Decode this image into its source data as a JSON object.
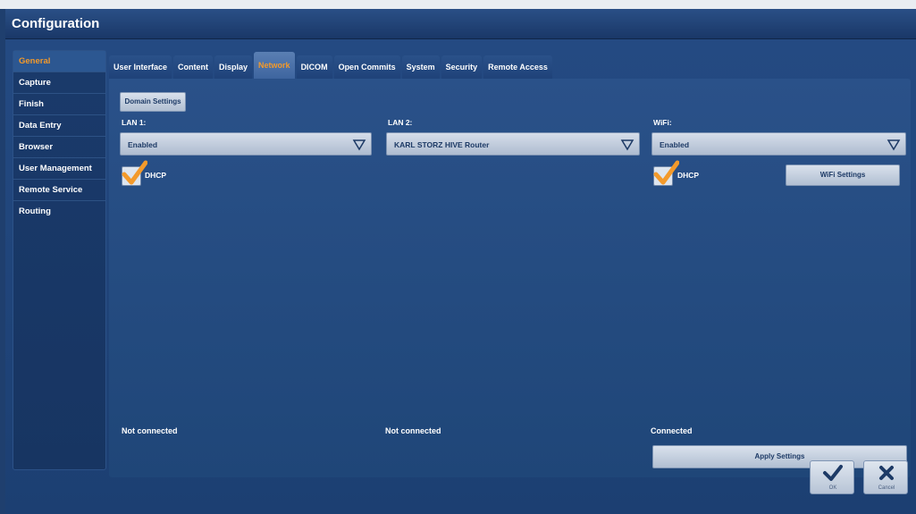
{
  "window": {
    "title": "Configuration"
  },
  "sidebar": {
    "items": [
      {
        "label": "General",
        "active": true
      },
      {
        "label": "Capture"
      },
      {
        "label": "Finish"
      },
      {
        "label": "Data Entry"
      },
      {
        "label": "Browser"
      },
      {
        "label": "User Management"
      },
      {
        "label": "Remote Service"
      },
      {
        "label": "Routing"
      }
    ]
  },
  "tabs": [
    {
      "label": "User Interface"
    },
    {
      "label": "Content"
    },
    {
      "label": "Display"
    },
    {
      "label": "Network",
      "active": true
    },
    {
      "label": "DICOM"
    },
    {
      "label": "Open Commits"
    },
    {
      "label": "System"
    },
    {
      "label": "Security"
    },
    {
      "label": "Remote Access"
    }
  ],
  "network": {
    "domain_settings_label": "Domain Settings",
    "lan1": {
      "label": "LAN 1:",
      "value": "Enabled",
      "dhcp_label": "DHCP",
      "dhcp_checked": true,
      "status": "Not connected"
    },
    "lan2": {
      "label": "LAN 2:",
      "value": "KARL STORZ HIVE Router",
      "status": "Not connected"
    },
    "wifi": {
      "label": "WiFi:",
      "value": "Enabled",
      "dhcp_label": "DHCP",
      "dhcp_checked": true,
      "settings_label": "WiFi Settings",
      "status": "Connected"
    },
    "apply_label": "Apply Settings"
  },
  "footer": {
    "ok_label": "OK",
    "cancel_label": "Cancel"
  },
  "colors": {
    "accent": "#f39a2b",
    "background": "#1f3f6e",
    "button": "#c9d4e2"
  },
  "icons": {
    "dropdown": "triangle-down-icon",
    "check": "checkmark-icon",
    "ok": "checkmark-icon",
    "cancel": "close-icon"
  }
}
